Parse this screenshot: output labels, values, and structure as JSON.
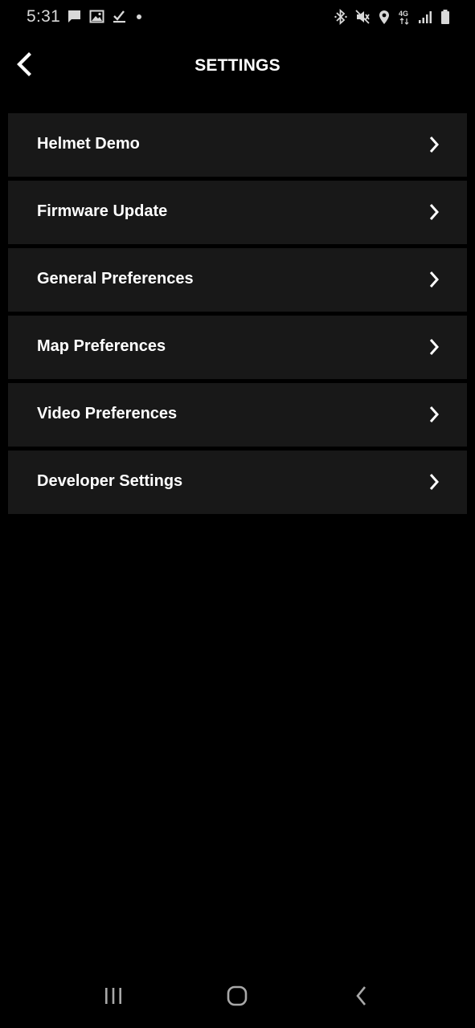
{
  "status_bar": {
    "time": "5:31",
    "left_icons": [
      "message-icon",
      "image-icon",
      "check-icon",
      "dot-icon"
    ],
    "right_icons": [
      "bluetooth-icon",
      "vibrate-mute-icon",
      "location-icon",
      "network-4g-icon",
      "signal-icon",
      "battery-icon"
    ],
    "network_label": "4G"
  },
  "header": {
    "title": "SETTINGS",
    "back_icon": "back-chevron-icon"
  },
  "menu": {
    "items": [
      {
        "label": "Helmet Demo"
      },
      {
        "label": "Firmware Update"
      },
      {
        "label": "General Preferences"
      },
      {
        "label": "Map Preferences"
      },
      {
        "label": "Video Preferences"
      },
      {
        "label": "Developer Settings"
      }
    ],
    "chevron_icon": "chevron-right-icon"
  },
  "nav_bar": {
    "icons": [
      "recent-apps-icon",
      "home-icon",
      "back-icon"
    ]
  },
  "colors": {
    "background": "#000000",
    "row_background": "#181818",
    "text": "#ffffff",
    "status_icon": "#d8d8d8"
  }
}
